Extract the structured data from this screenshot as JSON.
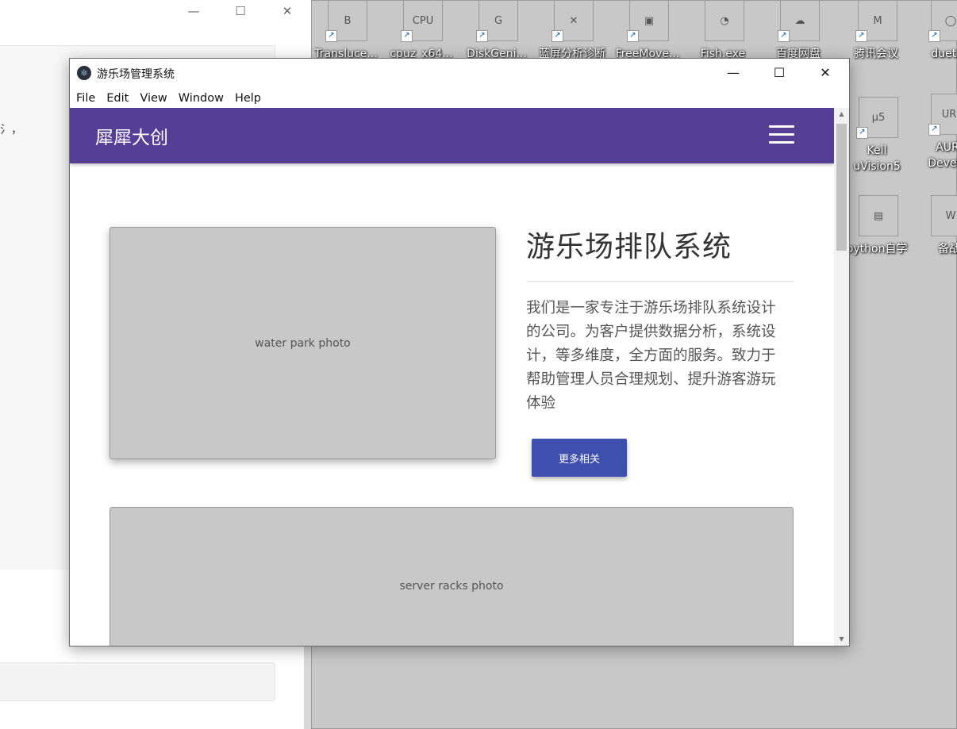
{
  "background_window": {
    "minimize_glyph": "—",
    "maximize_glyph": "☐",
    "close_glyph": "✕",
    "panel_text": "氵，"
  },
  "desktop": {
    "icons": [
      {
        "label": "Transluce...",
        "icon": "translucenttb-icon"
      },
      {
        "label": "cpuz_x64...",
        "icon": "cpu-z-icon"
      },
      {
        "label": "DiskGeni...",
        "icon": "diskgenius-icon"
      },
      {
        "label": "蓝屏分析诊断",
        "icon": "tools-icon"
      },
      {
        "label": "FreeMove...",
        "icon": "freemove-icon"
      },
      {
        "label": "Fish.exe",
        "icon": "fish-icon"
      },
      {
        "label": "百度网盘",
        "icon": "baidu-netdisk-icon"
      },
      {
        "label": "腾讯会议",
        "icon": "tencent-meeting-icon"
      },
      {
        "label": "duet...",
        "icon": "duet-icon"
      },
      {
        "label": "Keil uVision5",
        "icon": "keil-icon"
      },
      {
        "label": "AURI Devel...",
        "icon": "auri-icon"
      },
      {
        "label": "python自学",
        "icon": "folder-icon"
      },
      {
        "label": "备战",
        "icon": "word-folder-icon"
      }
    ]
  },
  "app": {
    "title": "游乐场管理系统",
    "minimize_glyph": "—",
    "maximize_glyph": "☐",
    "close_glyph": "✕",
    "menu": [
      "File",
      "Edit",
      "View",
      "Window",
      "Help"
    ],
    "navbar": {
      "brand": "犀犀大创",
      "brand_color": "#553f96"
    },
    "hero": {
      "title": "游乐场排队系统",
      "description": "我们是一家专注于游乐场排队系统设计的公司。为客户提供数据分析，系统设计，等多维度，全方面的服务。致力于帮助管理人员合理规划、提升游客游玩体验",
      "button_label": "更多相关",
      "button_color": "#3f4fae"
    }
  }
}
